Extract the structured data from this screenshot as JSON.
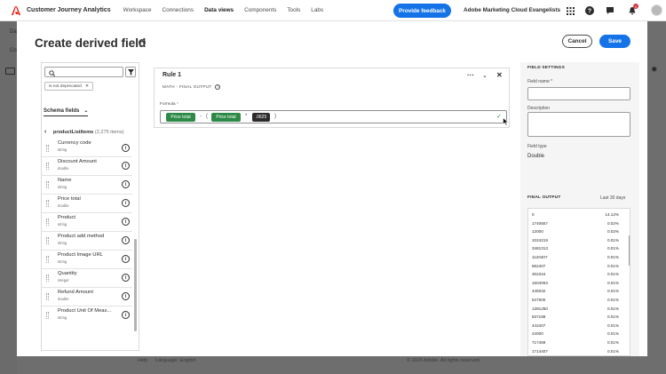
{
  "topnav": {
    "app_title": "Customer Journey Analytics",
    "items": [
      "Workspace",
      "Connections",
      "Data views",
      "Components",
      "Tools",
      "Labs"
    ],
    "active_index": 2,
    "feedback_label": "Provide feedback",
    "org_name": "Adobe Marketing Cloud Evangelists",
    "notification_count": "1"
  },
  "background": {
    "left_fragments": [
      "Da",
      "Co"
    ],
    "footer_help": "Help",
    "footer_language": "Language: English",
    "footer_copyright": "© 2024 Adobe. All rights reserved."
  },
  "modal": {
    "title": "Create derived field",
    "help": "?",
    "cancel_label": "Cancel",
    "save_label": "Save"
  },
  "left_panel": {
    "search_placeholder": "",
    "filter_chip": "is not deprecated",
    "schema_label": "Schema fields",
    "list_name": "productListItems",
    "list_count": "(2,275 items)",
    "fields": [
      {
        "name": "Currency code",
        "type": "string"
      },
      {
        "name": "Discount Amount",
        "type": "double"
      },
      {
        "name": "Name",
        "type": "string"
      },
      {
        "name": "Price total",
        "type": "double"
      },
      {
        "name": "Product",
        "type": "string"
      },
      {
        "name": "Product add method",
        "type": "string"
      },
      {
        "name": "Product Image URL",
        "type": "string"
      },
      {
        "name": "Quantity",
        "type": "integer"
      },
      {
        "name": "Refund Amount",
        "type": "double"
      },
      {
        "name": "Product Unit Of Meas...",
        "type": "string"
      }
    ]
  },
  "rule": {
    "title": "Rule 1",
    "subtitle": "MATH - FINAL OUTPUT",
    "formula_label": "Formula",
    "required_marker": "*",
    "tokens": {
      "t1": "Price total",
      "op1": "-",
      "paren_open": "(",
      "t2": "Price total",
      "op2": "*",
      "t3": ".0625",
      "paren_close": ")"
    }
  },
  "field_settings": {
    "heading": "FIELD SETTINGS",
    "field_name_label": "Field name",
    "description_label": "Description",
    "field_type_label": "Field type",
    "field_type_value": "Double",
    "final_output_heading": "FINAL OUTPUT",
    "last_days": "Last 30 days",
    "rows": [
      {
        "value": "0",
        "pct": "14.12%"
      },
      {
        "value": "1740657",
        "pct": "0.02%"
      },
      {
        "value": "12000",
        "pct": "0.02%"
      },
      {
        "value": "1024219",
        "pct": "0.01%"
      },
      {
        "value": "3481313",
        "pct": "0.01%"
      },
      {
        "value": "1120407",
        "pct": "0.01%"
      },
      {
        "value": "862407",
        "pct": "0.01%"
      },
      {
        "value": "302344",
        "pct": "0.01%"
      },
      {
        "value": "1604063",
        "pct": "0.01%"
      },
      {
        "value": "445032",
        "pct": "0.01%"
      },
      {
        "value": "547500",
        "pct": "0.01%"
      },
      {
        "value": "1391250",
        "pct": "0.01%"
      },
      {
        "value": "837188",
        "pct": "0.01%"
      },
      {
        "value": "442407",
        "pct": "0.01%"
      },
      {
        "value": "24000",
        "pct": "0.01%"
      },
      {
        "value": "717469",
        "pct": "0.01%"
      },
      {
        "value": "1714407",
        "pct": "0.01%"
      }
    ]
  },
  "colors": {
    "accent": "#1473e6",
    "token_green": "#2d8a46",
    "token_dark": "#2c2c2c",
    "adobe_red": "#eb1000"
  }
}
